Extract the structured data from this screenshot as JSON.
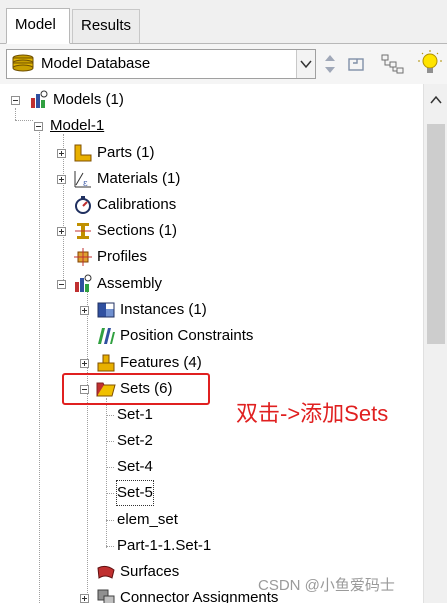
{
  "tabs": [
    {
      "label": "Model",
      "active": true
    },
    {
      "label": "Results",
      "active": false
    }
  ],
  "toolbar": {
    "combo_value": "Model Database",
    "icons": [
      "database-icon",
      "chevron-down-icon",
      "up-down-arrows-icon",
      "copy-icon",
      "tree-filter-icon",
      "lightbulb-icon"
    ]
  },
  "tree": {
    "models": "Models (1)",
    "model1": "Model-1",
    "parts": "Parts (1)",
    "materials": "Materials (1)",
    "calibrations": "Calibrations",
    "sections": "Sections (1)",
    "profiles": "Profiles",
    "assembly": "Assembly",
    "instances": "Instances (1)",
    "position_constraints": "Position Constraints",
    "features": "Features (4)",
    "sets": "Sets (6)",
    "set_items": [
      "Set-1",
      "Set-2",
      "Set-4",
      "Set-5",
      "elem_set",
      "Part-1-1.Set-1"
    ],
    "surfaces": "Surfaces",
    "connector_assignments": "Connector Assignments"
  },
  "annotation": "双击->添加Sets",
  "watermark": "CSDN @小鱼爱码士",
  "colors": {
    "highlight": "#e02020",
    "selection_box": "#e02020"
  }
}
